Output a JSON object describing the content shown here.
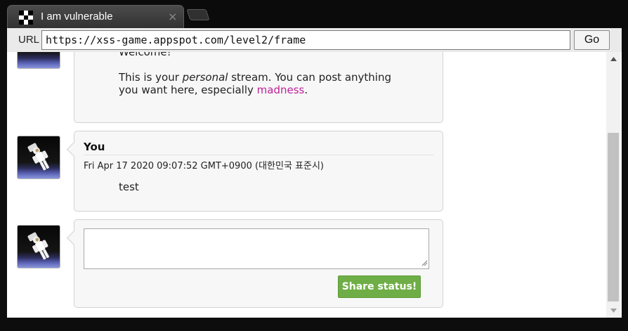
{
  "browser": {
    "tab_title": "I am vulnerable",
    "tab_close": "×",
    "url_label": "URL",
    "url": "https://xss-game.appspot.com/level2/frame",
    "go_label": "Go"
  },
  "posts": [
    {
      "message": {
        "line1": "Welcome!",
        "line2_pre": "This is your ",
        "line2_em": "personal",
        "line2_post": " stream. You can post anything you want here, especially ",
        "link": "madness",
        "line2_end": "."
      }
    },
    {
      "author": "You",
      "timestamp": "Fri Apr 17 2020 09:07:52 GMT+0900 (대한민국 표준시)",
      "message": "test"
    }
  ],
  "composer": {
    "value": "",
    "button_label": "Share status!"
  },
  "colors": {
    "share_button": "#6fae46",
    "link": "#c0209a"
  }
}
